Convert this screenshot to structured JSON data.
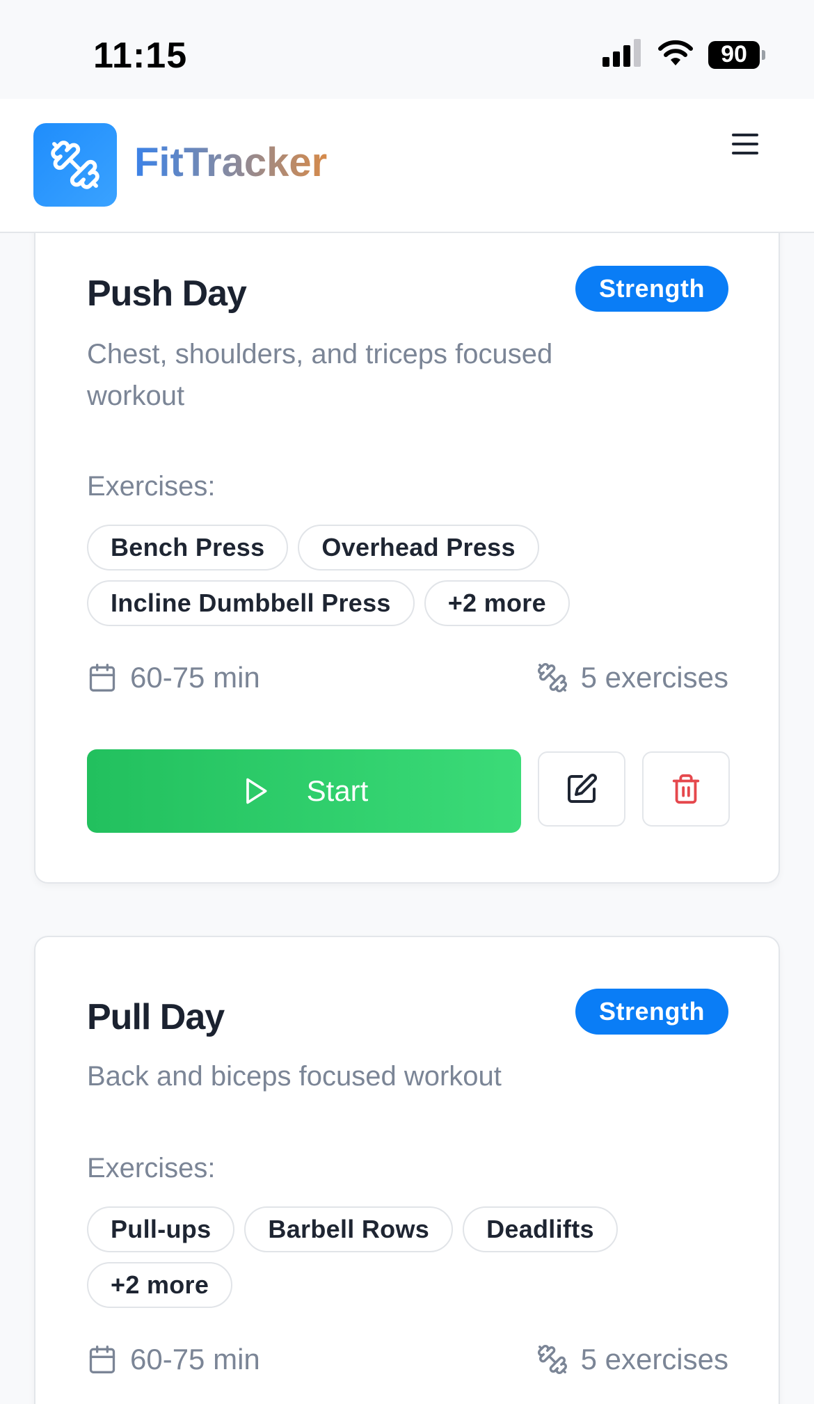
{
  "status_bar": {
    "time": "11:15",
    "battery": "90"
  },
  "header": {
    "brand": "FitTracker"
  },
  "workouts": [
    {
      "title": "Push Day",
      "tag": "Strength",
      "description": "Chest, shoulders, and triceps focused workout",
      "exercises_label": "Exercises:",
      "chips": [
        "Bench Press",
        "Overhead Press",
        "Incline Dumbbell Press",
        "+2 more"
      ],
      "duration": "60-75 min",
      "exercise_count": "5 exercises",
      "start_label": "Start"
    },
    {
      "title": "Pull Day",
      "tag": "Strength",
      "description": "Back and biceps focused workout",
      "exercises_label": "Exercises:",
      "chips": [
        "Pull-ups",
        "Barbell Rows",
        "Deadlifts",
        "+2 more"
      ],
      "duration": "60-75 min",
      "exercise_count": "5 exercises"
    }
  ],
  "colors": {
    "accent": "#0a7df6",
    "start": "#22c05e",
    "delete": "#e5484d"
  }
}
